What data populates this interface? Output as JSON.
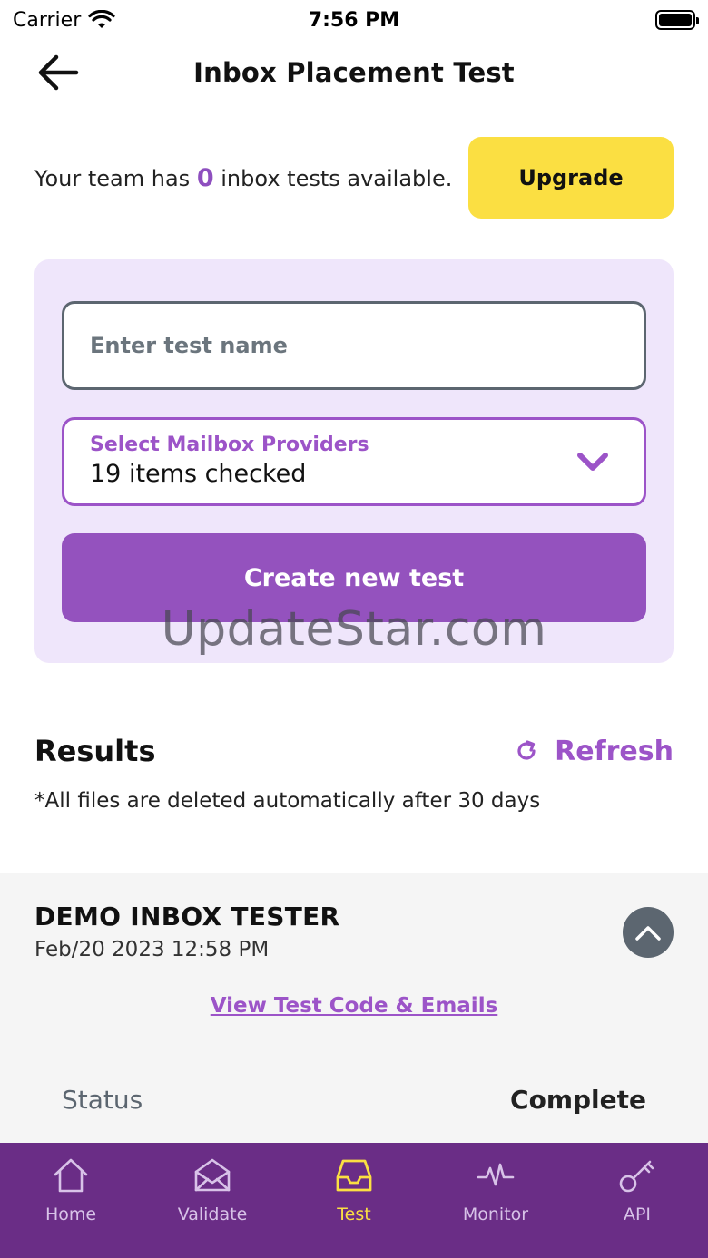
{
  "status_bar": {
    "carrier": "Carrier",
    "time": "7:56 PM"
  },
  "header": {
    "title": "Inbox Placement Test"
  },
  "credits": {
    "prefix": "Your team has",
    "count": "0",
    "suffix": "inbox tests available.",
    "upgrade_label": "Upgrade"
  },
  "form": {
    "test_name_placeholder": "Enter test name",
    "test_name_value": "",
    "providers_label": "Select Mailbox Providers",
    "providers_value": "19 items checked",
    "create_label": "Create new test"
  },
  "watermark": "UpdateStar.com",
  "results": {
    "title": "Results",
    "refresh_label": "Refresh",
    "note": "*All files are deleted automatically after 30 days",
    "items": [
      {
        "name": "DEMO INBOX TESTER",
        "date": "Feb/20 2023 12:58 PM",
        "link_label": "View Test Code & Emails",
        "status_label": "Status",
        "status_value": "Complete"
      }
    ]
  },
  "tabs": [
    {
      "label": "Home",
      "icon": "home-icon"
    },
    {
      "label": "Validate",
      "icon": "envelope-open-icon"
    },
    {
      "label": "Test",
      "icon": "inbox-tray-icon",
      "active": true
    },
    {
      "label": "Monitor",
      "icon": "pulse-icon"
    },
    {
      "label": "API",
      "icon": "key-icon"
    }
  ],
  "colors": {
    "accent_purple": "#9c54c8",
    "button_purple": "#9452be",
    "tab_bar": "#6a2d86",
    "upgrade_yellow": "#fbdf42",
    "card_lavender": "#efe6fb"
  }
}
